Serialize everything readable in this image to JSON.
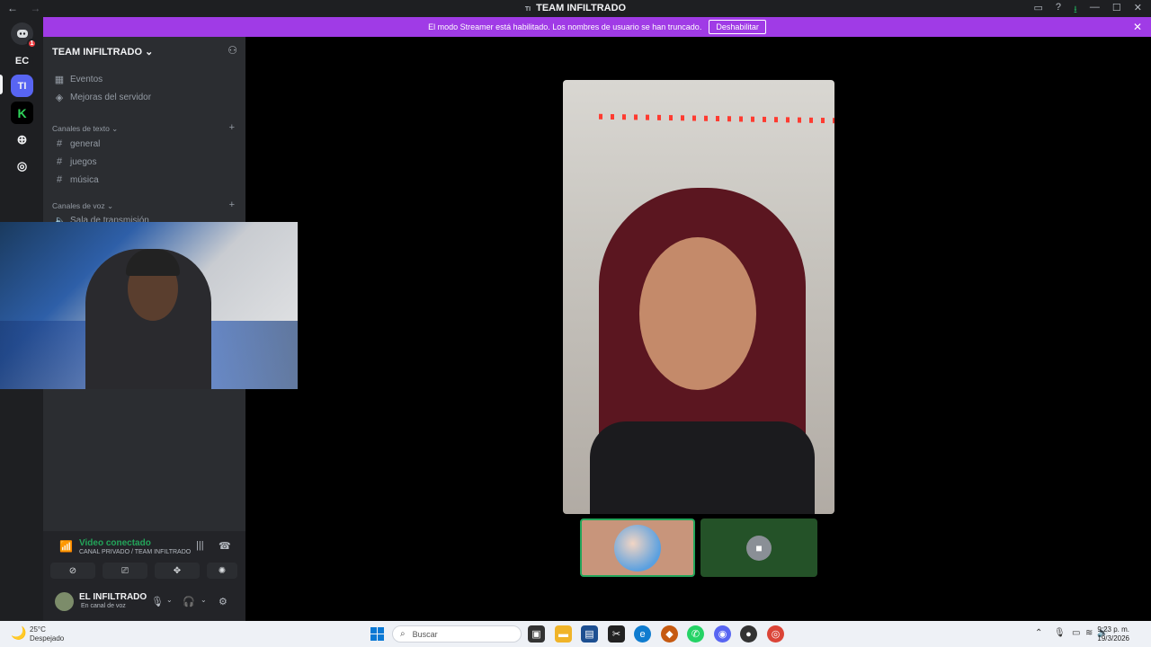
{
  "titlebar": {
    "title": "TEAM INFILTRADO",
    "back": "←",
    "forward": "→"
  },
  "banner": {
    "message": "El modo Streamer está habilitado. Los nombres de usuario se han truncado.",
    "button": "Deshabilitar"
  },
  "rail": {
    "servers": [
      {
        "label": "EC"
      },
      {
        "label": "TI"
      }
    ],
    "dm_badge": "1"
  },
  "sidebar": {
    "server_name": "TEAM INFILTRADO",
    "items": [
      {
        "label": "Eventos"
      },
      {
        "label": "Mejoras del servidor"
      }
    ],
    "text_category": "Canales de texto",
    "text_channels": [
      {
        "label": "general"
      },
      {
        "label": "juegos"
      },
      {
        "label": "música"
      }
    ],
    "voice_category": "Canales de voz",
    "voice_channels": [
      {
        "label": "Sala de transmisión"
      }
    ]
  },
  "voice": {
    "status": "Video conectado",
    "channel": "CANAL PRIVADO / TEAM INFILTRADO"
  },
  "user": {
    "name": "EL INFILTRADO",
    "status": "En canal de voz"
  },
  "taskbar": {
    "temperature": "25°C",
    "weather": "Despejado",
    "search_placeholder": "Buscar",
    "time": "9:23 p. m.",
    "date": "19/3/2026"
  }
}
